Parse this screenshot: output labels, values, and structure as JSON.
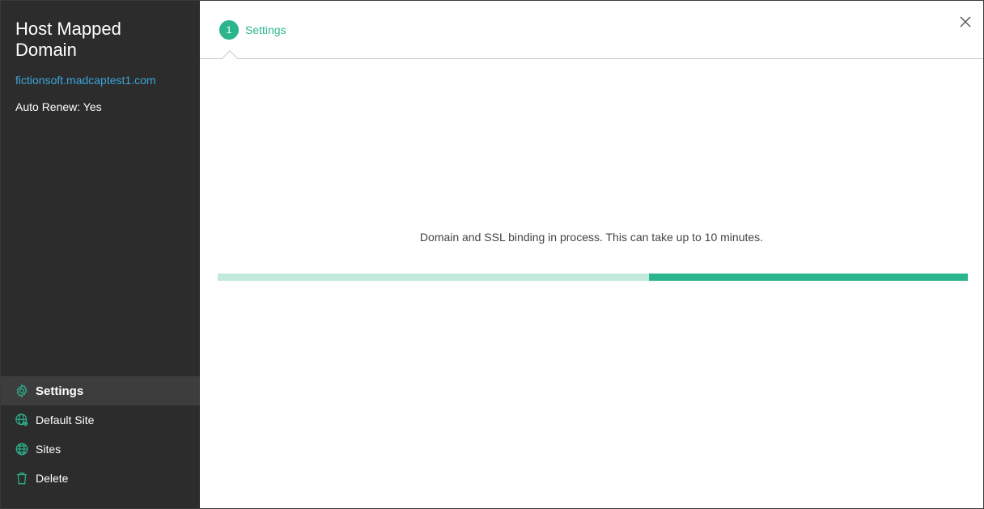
{
  "sidebar": {
    "title": "Host Mapped Domain",
    "domain": "fictionsoft.madcaptest1.com",
    "auto_renew": "Auto Renew: Yes",
    "nav": [
      {
        "label": "Settings",
        "icon": "gear-icon",
        "active": true
      },
      {
        "label": "Default Site",
        "icon": "globe-settings-icon",
        "active": false
      },
      {
        "label": "Sites",
        "icon": "globe-icon",
        "active": false
      },
      {
        "label": "Delete",
        "icon": "trash-icon",
        "active": false
      }
    ]
  },
  "main": {
    "step": {
      "number": "1",
      "label": "Settings"
    },
    "message": "Domain and SSL binding in process. This can take up to 10 minutes.",
    "progress_fraction": 0.425
  },
  "colors": {
    "accent": "#2bb58d",
    "accent_light": "#c3e8dc",
    "sidebar_bg": "#2c2c2c",
    "link": "#3aa5d8"
  }
}
